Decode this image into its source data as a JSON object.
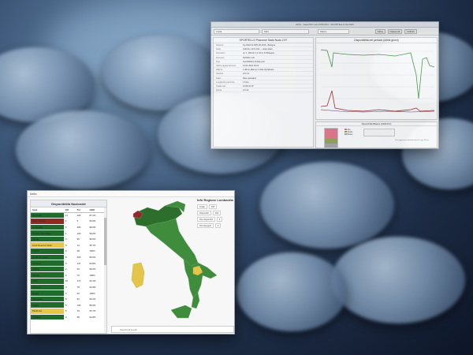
{
  "top_window": {
    "title": "DOG - Searchfor HA 1/05/2024 - SPORTELLO-SL2026",
    "toolbar": {
      "field1": "Imola",
      "field2": "Filtri",
      "field3": "Marzo",
      "btn1": "Filtra",
      "btn2": "Nascondi",
      "btn3": "Indietro"
    },
    "left_pane_title": "SPORTELLO Piazzone Stato Nodo 2.97",
    "details": [
      {
        "k": "Sistema",
        "v": "SL-4002 NI DPS 08 4016 - Bologna"
      },
      {
        "k": "Nodo",
        "v": "Indirizzo 10.5.4.62 — stato attivo"
      },
      {
        "k": "Inventario",
        "v": "Lp 1, 109.29, 4.1.10.9, dir Bologna"
      },
      {
        "k": "Percorso",
        "v": "NOVAN 1.25"
      },
      {
        "k": "Tipo",
        "v": "SLV/ARD01.10.bdp.com"
      },
      {
        "k": "Ultimo aggiornamento",
        "v": "14.01.2024 23:10"
      },
      {
        "k": "Allarmi",
        "v": "L'ultimo allarme è stato ripristinato"
      },
      {
        "k": "Gestore",
        "v": "LIS 2.0"
      },
      {
        "k": "Stato",
        "v": "Rete operativa"
      },
      {
        "k": "Lunghezza percorso",
        "v": "1.5 km"
      },
      {
        "k": "Totale cavi",
        "v": "14.08 10.07"
      },
      {
        "k": "Quota",
        "v": "2.0 rel."
      }
    ],
    "chart_title": "Disponibilità nel periodo (ultimi giorni)",
    "bar_title": "Disponibilità Bilatera (GRAFICO)",
    "legend": [
      "Alto",
      "Medio",
      "Basso"
    ],
    "note": "Dati aggiornati automaticamente ogni 24 ore"
  },
  "bottom_window": {
    "header": "Italia",
    "panel_title": "Disponibilità Nazionale",
    "columns": [
      "Area",
      "KO",
      "Tot",
      "%OK"
    ],
    "rows": [
      {
        "area": "Piemonte",
        "ko": "11",
        "tot": "220",
        "pct": "87.2%",
        "color": "#1f6b2b"
      },
      {
        "area": "Valle d'Aosta",
        "ko": "1",
        "tot": "5",
        "pct": "80.0%",
        "color": "#8e2a22"
      },
      {
        "area": "Lombardia",
        "ko": "6",
        "tot": "280",
        "pct": "98.0%",
        "color": "#1f6b2b"
      },
      {
        "area": "Trentino Alto Adige",
        "ko": "1",
        "tot": "100",
        "pct": "99.0%",
        "color": "#1f6b2b"
      },
      {
        "area": "Veneto",
        "ko": "3",
        "tot": "90",
        "pct": "96.6%",
        "color": "#1f6b2b"
      },
      {
        "area": "Friuli Venezia Giulia",
        "ko": "9",
        "tot": "14",
        "pct": "35.7%",
        "color": "#e5c84a"
      },
      {
        "area": "Liguria",
        "ko": "0",
        "tot": "48",
        "pct": "100%",
        "color": "#1f6b2b"
      },
      {
        "area": "Emilia Romagna",
        "ko": "8",
        "tot": "200",
        "pct": "96.0%",
        "color": "#1f6b2b"
      },
      {
        "area": "Toscana",
        "ko": "9",
        "tot": "147",
        "pct": "93.8%",
        "color": "#1f6b2b"
      },
      {
        "area": "Umbria",
        "ko": "2",
        "tot": "50",
        "pct": "96.0%",
        "color": "#1f6b2b"
      },
      {
        "area": "Marche",
        "ko": "0",
        "tot": "70",
        "pct": "100%",
        "color": "#1f6b2b"
      },
      {
        "area": "Lazio",
        "ko": "10",
        "tot": "172",
        "pct": "94.1%",
        "color": "#1f6b2b"
      },
      {
        "area": "Abruzzo",
        "ko": "4",
        "tot": "78",
        "pct": "94.9%",
        "color": "#1f6b2b"
      },
      {
        "area": "Molise",
        "ko": "0",
        "tot": "20",
        "pct": "100%",
        "color": "#1f6b2b"
      },
      {
        "area": "Campania",
        "ko": "8",
        "tot": "92",
        "pct": "90.2%",
        "color": "#1f6b2b"
      },
      {
        "area": "Puglia",
        "ko": "5",
        "tot": "100",
        "pct": "95.0%",
        "color": "#1f6b2b"
      },
      {
        "area": "Basilicata",
        "ko": "5",
        "tot": "15",
        "pct": "66.7%",
        "color": "#e5c84a"
      },
      {
        "area": "Calabria",
        "ko": "3",
        "tot": "58",
        "pct": "94.8%",
        "color": "#1f6b2b"
      }
    ],
    "info_title": "Info Regione Lombardia",
    "info_cells": [
      "Totale",
      "200",
      "Disponibili",
      "194",
      "Non disponibili",
      "6",
      "Non Eseguiti",
      "0"
    ],
    "search_placeholder": "Seleziona luoghi",
    "map_colors": {
      "green": "#3f8d3c",
      "dark_green": "#2e6e2d",
      "yellow": "#e2c549",
      "red": "#8c2b2b"
    }
  }
}
